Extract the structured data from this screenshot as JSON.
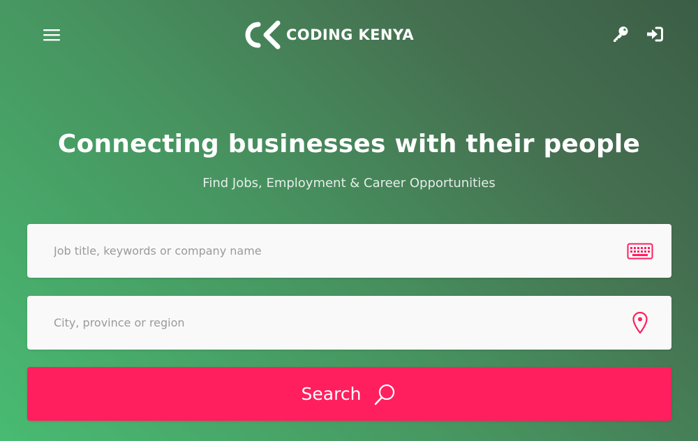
{
  "header": {
    "brand_name": "CODING KENYA",
    "menu_icon": "hamburger-menu-icon",
    "key_icon": "key-icon",
    "signin_icon": "sign-in-icon"
  },
  "hero": {
    "title": "Connecting businesses with their people",
    "subtitle": "Find Jobs, Employment & Career Opportunities"
  },
  "search_form": {
    "keyword": {
      "placeholder": "Job title, keywords or company name",
      "value": "",
      "icon": "keyboard-icon"
    },
    "location": {
      "placeholder": "City, province or region",
      "value": "",
      "icon": "map-pin-icon"
    },
    "submit_label": "Search",
    "submit_icon": "search-icon"
  },
  "colors": {
    "accent": "#ff1f5f",
    "gradient_light": "#48bb72",
    "gradient_dark": "#3b5e46",
    "field_background": "#f9f9f9"
  }
}
